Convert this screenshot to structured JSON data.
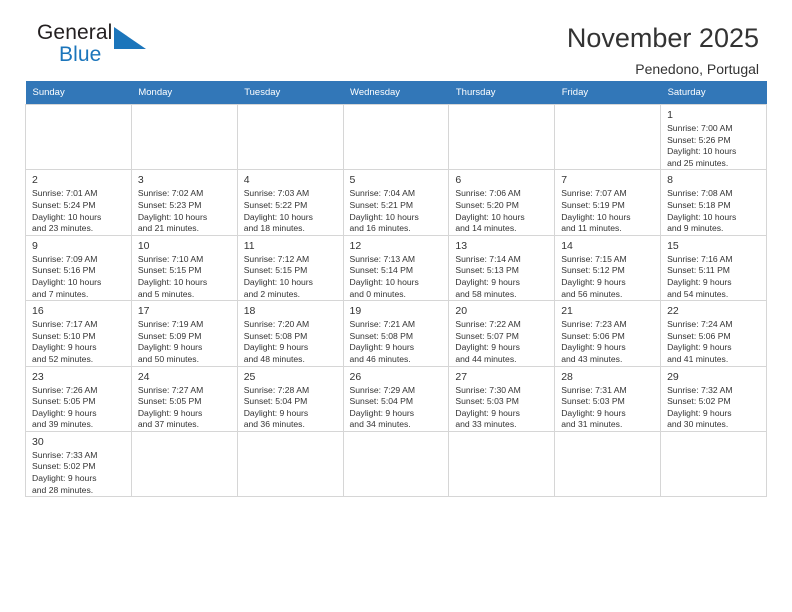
{
  "brand": {
    "name_top": "General",
    "name_bottom": "Blue",
    "accent_color": "#1b75bb"
  },
  "header": {
    "title": "November 2025",
    "subtitle": "Penedono, Portugal"
  },
  "calendar": {
    "header_bg": "#3277b8",
    "weekdays": [
      "Sunday",
      "Monday",
      "Tuesday",
      "Wednesday",
      "Thursday",
      "Friday",
      "Saturday"
    ],
    "weeks": [
      [
        {
          "day": "",
          "info": ""
        },
        {
          "day": "",
          "info": ""
        },
        {
          "day": "",
          "info": ""
        },
        {
          "day": "",
          "info": ""
        },
        {
          "day": "",
          "info": ""
        },
        {
          "day": "",
          "info": ""
        },
        {
          "day": "1",
          "info": "Sunrise: 7:00 AM\nSunset: 5:26 PM\nDaylight: 10 hours\nand 25 minutes."
        }
      ],
      [
        {
          "day": "2",
          "info": "Sunrise: 7:01 AM\nSunset: 5:24 PM\nDaylight: 10 hours\nand 23 minutes."
        },
        {
          "day": "3",
          "info": "Sunrise: 7:02 AM\nSunset: 5:23 PM\nDaylight: 10 hours\nand 21 minutes."
        },
        {
          "day": "4",
          "info": "Sunrise: 7:03 AM\nSunset: 5:22 PM\nDaylight: 10 hours\nand 18 minutes."
        },
        {
          "day": "5",
          "info": "Sunrise: 7:04 AM\nSunset: 5:21 PM\nDaylight: 10 hours\nand 16 minutes."
        },
        {
          "day": "6",
          "info": "Sunrise: 7:06 AM\nSunset: 5:20 PM\nDaylight: 10 hours\nand 14 minutes."
        },
        {
          "day": "7",
          "info": "Sunrise: 7:07 AM\nSunset: 5:19 PM\nDaylight: 10 hours\nand 11 minutes."
        },
        {
          "day": "8",
          "info": "Sunrise: 7:08 AM\nSunset: 5:18 PM\nDaylight: 10 hours\nand 9 minutes."
        }
      ],
      [
        {
          "day": "9",
          "info": "Sunrise: 7:09 AM\nSunset: 5:16 PM\nDaylight: 10 hours\nand 7 minutes."
        },
        {
          "day": "10",
          "info": "Sunrise: 7:10 AM\nSunset: 5:15 PM\nDaylight: 10 hours\nand 5 minutes."
        },
        {
          "day": "11",
          "info": "Sunrise: 7:12 AM\nSunset: 5:15 PM\nDaylight: 10 hours\nand 2 minutes."
        },
        {
          "day": "12",
          "info": "Sunrise: 7:13 AM\nSunset: 5:14 PM\nDaylight: 10 hours\nand 0 minutes."
        },
        {
          "day": "13",
          "info": "Sunrise: 7:14 AM\nSunset: 5:13 PM\nDaylight: 9 hours\nand 58 minutes."
        },
        {
          "day": "14",
          "info": "Sunrise: 7:15 AM\nSunset: 5:12 PM\nDaylight: 9 hours\nand 56 minutes."
        },
        {
          "day": "15",
          "info": "Sunrise: 7:16 AM\nSunset: 5:11 PM\nDaylight: 9 hours\nand 54 minutes."
        }
      ],
      [
        {
          "day": "16",
          "info": "Sunrise: 7:17 AM\nSunset: 5:10 PM\nDaylight: 9 hours\nand 52 minutes."
        },
        {
          "day": "17",
          "info": "Sunrise: 7:19 AM\nSunset: 5:09 PM\nDaylight: 9 hours\nand 50 minutes."
        },
        {
          "day": "18",
          "info": "Sunrise: 7:20 AM\nSunset: 5:08 PM\nDaylight: 9 hours\nand 48 minutes."
        },
        {
          "day": "19",
          "info": "Sunrise: 7:21 AM\nSunset: 5:08 PM\nDaylight: 9 hours\nand 46 minutes."
        },
        {
          "day": "20",
          "info": "Sunrise: 7:22 AM\nSunset: 5:07 PM\nDaylight: 9 hours\nand 44 minutes."
        },
        {
          "day": "21",
          "info": "Sunrise: 7:23 AM\nSunset: 5:06 PM\nDaylight: 9 hours\nand 43 minutes."
        },
        {
          "day": "22",
          "info": "Sunrise: 7:24 AM\nSunset: 5:06 PM\nDaylight: 9 hours\nand 41 minutes."
        }
      ],
      [
        {
          "day": "23",
          "info": "Sunrise: 7:26 AM\nSunset: 5:05 PM\nDaylight: 9 hours\nand 39 minutes."
        },
        {
          "day": "24",
          "info": "Sunrise: 7:27 AM\nSunset: 5:05 PM\nDaylight: 9 hours\nand 37 minutes."
        },
        {
          "day": "25",
          "info": "Sunrise: 7:28 AM\nSunset: 5:04 PM\nDaylight: 9 hours\nand 36 minutes."
        },
        {
          "day": "26",
          "info": "Sunrise: 7:29 AM\nSunset: 5:04 PM\nDaylight: 9 hours\nand 34 minutes."
        },
        {
          "day": "27",
          "info": "Sunrise: 7:30 AM\nSunset: 5:03 PM\nDaylight: 9 hours\nand 33 minutes."
        },
        {
          "day": "28",
          "info": "Sunrise: 7:31 AM\nSunset: 5:03 PM\nDaylight: 9 hours\nand 31 minutes."
        },
        {
          "day": "29",
          "info": "Sunrise: 7:32 AM\nSunset: 5:02 PM\nDaylight: 9 hours\nand 30 minutes."
        }
      ],
      [
        {
          "day": "30",
          "info": "Sunrise: 7:33 AM\nSunset: 5:02 PM\nDaylight: 9 hours\nand 28 minutes."
        },
        {
          "day": "",
          "info": ""
        },
        {
          "day": "",
          "info": ""
        },
        {
          "day": "",
          "info": ""
        },
        {
          "day": "",
          "info": ""
        },
        {
          "day": "",
          "info": ""
        },
        {
          "day": "",
          "info": ""
        }
      ]
    ]
  }
}
